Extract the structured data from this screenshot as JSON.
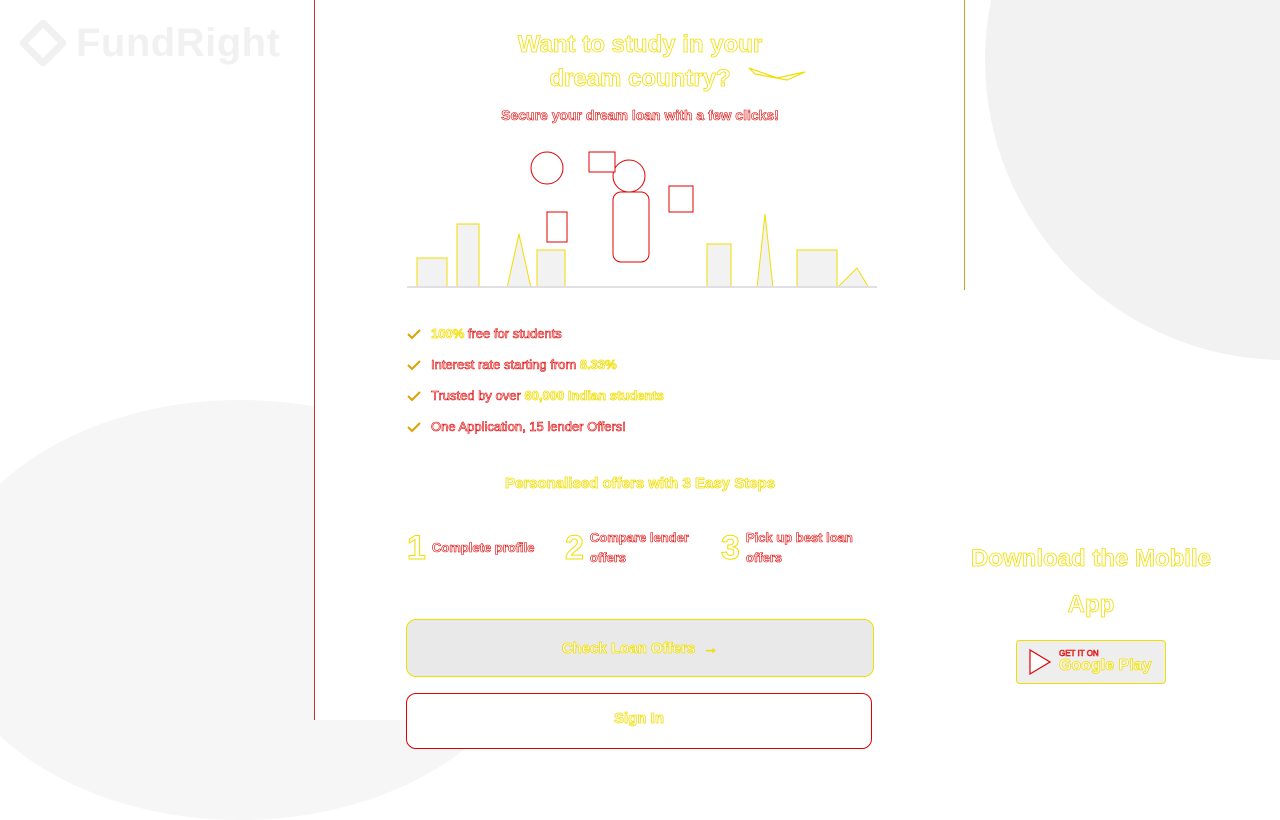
{
  "brand": {
    "name": "FundRight",
    "logo_icon": "diamond-logo-icon"
  },
  "hero": {
    "title_line1": "Want to study in your",
    "title_line2": "dream country?",
    "subtitle": "Secure your dream loan with a few clicks!"
  },
  "benefits": [
    {
      "bold": "100%",
      "text": " free for students"
    },
    {
      "text": "Interest rate starting from ",
      "bold": "8.33%"
    },
    {
      "text": "Trusted by over ",
      "bold": "60,000 Indian students"
    },
    {
      "text": "One Application, 15 lender Offers!"
    }
  ],
  "steps_section": {
    "title": "Personalised offers with 3 Easy Steps",
    "steps": [
      {
        "num": "1",
        "label": "Complete profile"
      },
      {
        "num": "2",
        "label": "Compare lender offers"
      },
      {
        "num": "3",
        "label": "Pick up best loan offers"
      }
    ]
  },
  "cta": {
    "label": "Check Loan Offers",
    "icon": "arrow-right-icon"
  },
  "signin": {
    "label": "Sign In"
  },
  "mobile": {
    "title_line1": "Download the Mobile",
    "title_line2": "App",
    "store_small": "GET IT ON",
    "store_big": "Google Play"
  },
  "colors": {
    "accent_yellow": "#f0de00",
    "accent_red": "#e00000"
  }
}
